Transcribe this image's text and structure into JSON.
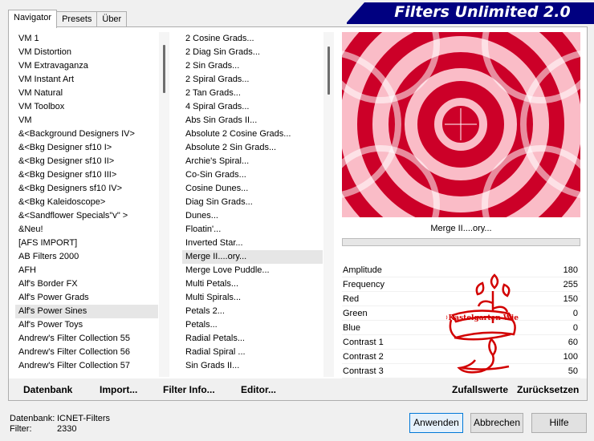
{
  "tabs": [
    {
      "label": "Navigator",
      "active": true
    },
    {
      "label": "Presets",
      "active": false
    },
    {
      "label": "Über",
      "active": false
    }
  ],
  "banner": {
    "title": "Filters Unlimited 2.0",
    "color": "#000080"
  },
  "categories": {
    "items": [
      "VM 1",
      "VM Distortion",
      "VM Extravaganza",
      "VM Instant Art",
      "VM Natural",
      "VM Toolbox",
      "VM",
      "&<Background Designers IV>",
      "&<Bkg Designer sf10 I>",
      "&<Bkg Designer sf10 II>",
      "&<Bkg Designer sf10 III>",
      "&<Bkg Designers sf10 IV>",
      "&<Bkg Kaleidoscope>",
      "&<Sandflower Specials\"v\" >",
      "&Neu!",
      "[AFS IMPORT]",
      "AB Filters 2000",
      "AFH",
      "Alf's Border FX",
      "Alf's Power Grads",
      "Alf's Power Sines",
      "Alf's Power Toys",
      "Andrew's Filter Collection 55",
      "Andrew's Filter Collection 56",
      "Andrew's Filter Collection 57"
    ],
    "selected": "Alf's Power Sines"
  },
  "filters": {
    "items": [
      "2 Cosine Grads...",
      "2 Diag Sin Grads...",
      "2 Sin Grads...",
      "2 Spiral Grads...",
      "2 Tan Grads...",
      "4 Spiral Grads...",
      "Abs Sin Grads II...",
      "Absolute 2 Cosine Grads...",
      "Absolute 2 Sin Grads...",
      "Archie's Spiral...",
      "Co-Sin Grads...",
      "Cosine Dunes...",
      "Diag Sin Grads...",
      "Dunes...",
      "Floatin'...",
      "Inverted Star...",
      "Merge II....ory...",
      "Merge Love Puddle...",
      "Multi Petals...",
      "Multi Spirals...",
      "Petals 2...",
      "Petals...",
      "Radial Petals...",
      "Radial Spiral ...",
      "Sin Grads II..."
    ],
    "selected": "Merge II....ory..."
  },
  "preview": {
    "filter_name": "Merge II....ory...",
    "progress": 0
  },
  "params": [
    {
      "label": "Amplitude",
      "value": "180"
    },
    {
      "label": "Frequency",
      "value": "255"
    },
    {
      "label": "Red",
      "value": "150"
    },
    {
      "label": "Green",
      "value": "0"
    },
    {
      "label": "Blue",
      "value": "0"
    },
    {
      "label": "Contrast 1",
      "value": "60"
    },
    {
      "label": "Contrast 2",
      "value": "100"
    },
    {
      "label": "Contrast 3",
      "value": "50"
    }
  ],
  "watermark": {
    "text": "©Kastelgarten Wien",
    "color": "#d20000"
  },
  "toolbar": {
    "datenbank": "Datenbank",
    "import": "Import...",
    "filter_info": "Filter Info...",
    "editor": "Editor...",
    "zufallswerte": "Zufallswerte",
    "zuruecksetzen": "Zurücksetzen"
  },
  "status": {
    "db_label": "Datenbank:",
    "db_value": "ICNET-Filters",
    "filter_label": "Filter:",
    "filter_value": "2330"
  },
  "buttons": {
    "apply": "Anwenden",
    "cancel": "Abbrechen",
    "help": "Hilfe"
  }
}
